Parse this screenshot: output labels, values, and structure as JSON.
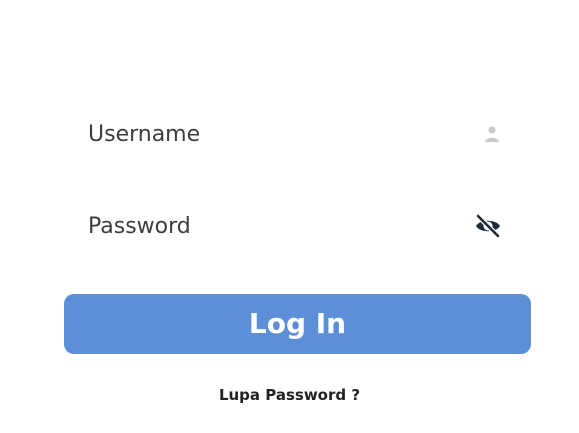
{
  "form": {
    "username": {
      "placeholder": "Username",
      "value": "",
      "icon": "user-icon"
    },
    "password": {
      "placeholder": "Password",
      "value": "",
      "icon": "eye-off-icon"
    },
    "login_label": "Log In",
    "forgot_password_label": "Lupa Password ?"
  },
  "colors": {
    "primary": "#5c8fd6",
    "text": "#3d3d3d",
    "background": "#ffffff",
    "icon_muted": "#c8c8c8",
    "icon_dark": "#1e2a35"
  }
}
